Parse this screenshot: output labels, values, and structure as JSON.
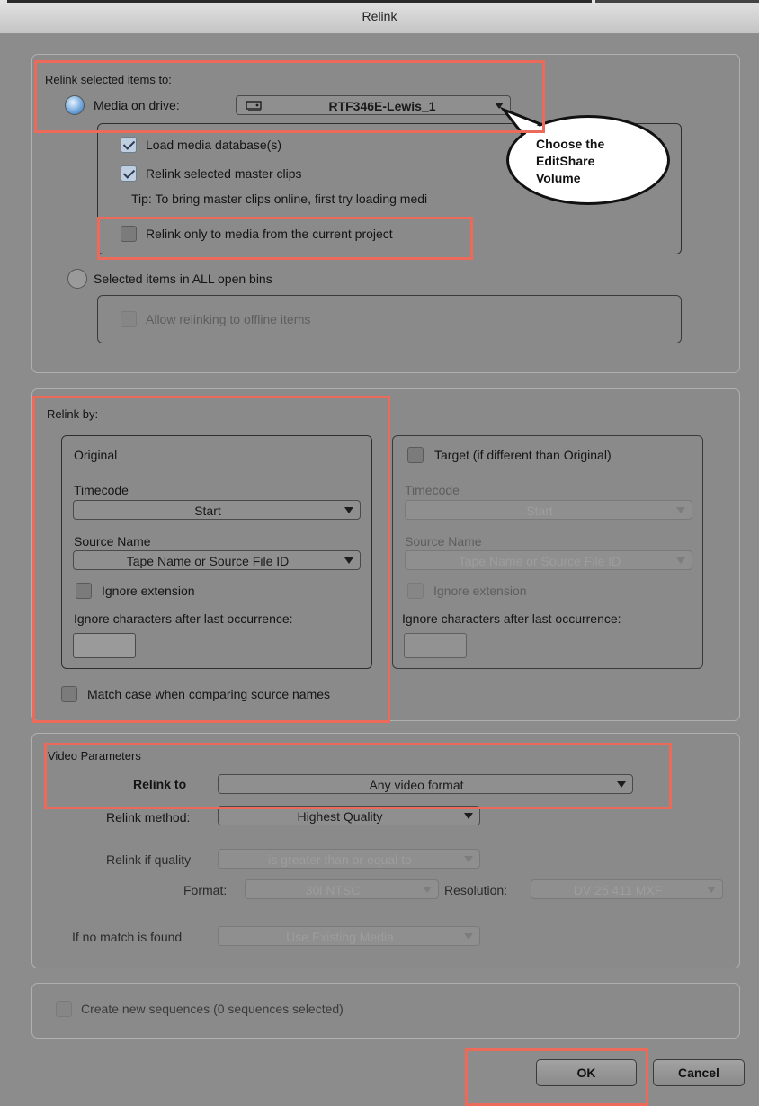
{
  "window": {
    "title": "Relink"
  },
  "relink_target": {
    "heading": "Relink selected items to:",
    "media_on_drive_label": "Media on drive:",
    "media_on_drive_selected": true,
    "drive_value": "RTF346E-Lewis_1",
    "load_media_db_label": "Load media database(s)",
    "load_media_db_checked": true,
    "relink_master_label": "Relink selected master clips",
    "relink_master_checked": true,
    "tip": "Tip: To bring master clips online, first try loading medi",
    "relink_project_label": "Relink only to media from the current project",
    "relink_project_checked": false,
    "selected_bins_label": "Selected items in ALL open bins",
    "allow_offline_label": "Allow relinking to offline items",
    "allow_offline_checked": false
  },
  "callout": {
    "lines": [
      "Choose the",
      "EditShare",
      "Volume"
    ]
  },
  "relink_by": {
    "heading": "Relink by:",
    "original": {
      "title": "Original",
      "timecode_label": "Timecode",
      "timecode_value": "Start",
      "source_name_label": "Source Name",
      "source_name_value": "Tape Name or Source File ID",
      "ignore_ext_label": "Ignore extension",
      "ignore_chars_label": "Ignore characters after last occurrence:"
    },
    "target": {
      "title": "Target (if different than Original)",
      "timecode_label": "Timecode",
      "timecode_value": "Start",
      "source_name_label": "Source Name",
      "source_name_value": "Tape Name or Source File ID",
      "ignore_ext_label": "Ignore extension",
      "ignore_chars_label": "Ignore characters after last occurrence:"
    },
    "match_case_label": "Match case when comparing source names"
  },
  "video": {
    "heading": "Video Parameters",
    "relink_to_label": "Relink to",
    "relink_to_value": "Any video format",
    "method_label": "Relink method:",
    "method_value": "Highest Quality",
    "quality_label": "Relink if quality",
    "quality_value": "is greater than or equal to",
    "format_label": "Format:",
    "format_value": "30i NTSC",
    "resolution_label": "Resolution:",
    "resolution_value": "DV 25 411 MXF",
    "no_match_label": "If no match is found",
    "no_match_value": "Use Existing Media"
  },
  "sequences": {
    "label": "Create new sequences  (0 sequences selected)"
  },
  "buttons": {
    "ok": "OK",
    "cancel": "Cancel"
  },
  "colors": {
    "highlight": "#ec6a5a",
    "dialog_bg": "#8c8c8c"
  }
}
